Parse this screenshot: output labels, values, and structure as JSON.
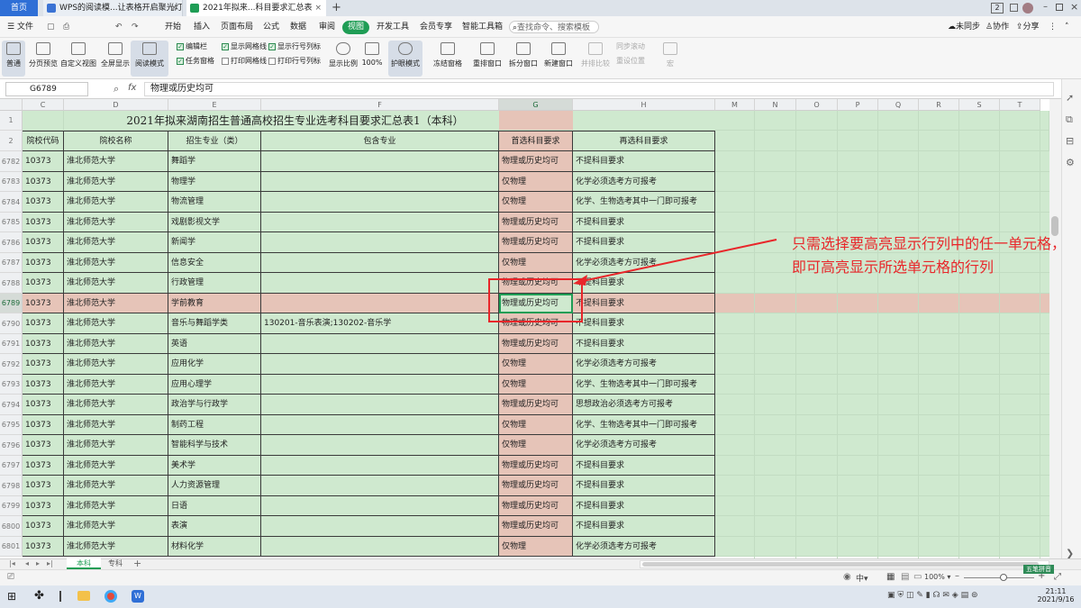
{
  "tabs": [
    {
      "label": "首页",
      "active": false,
      "icon": "home-tab"
    },
    {
      "label": "WPS的阅读模...让表格开启聚光灯",
      "active": false,
      "icon": "wps-doc-icon"
    },
    {
      "label": "2021年拟来...科目要求汇总表",
      "active": true,
      "icon": "sheet-icon"
    }
  ],
  "window_badge": "2",
  "menu": {
    "file": "文件",
    "items": [
      "开始",
      "插入",
      "页面布局",
      "公式",
      "数据",
      "审阅",
      "视图",
      "开发工具",
      "会员专享",
      "智能工具箱"
    ],
    "active_item": "视图",
    "search": "查找命令、搜索模板",
    "unsynced": "未同步",
    "collab": "协作",
    "share": "分享"
  },
  "ribbon": {
    "buttons1": [
      "普通",
      "分页预览",
      "自定义视图",
      "全屏显示",
      "阅读模式"
    ],
    "checks": [
      {
        "label": "编辑栏",
        "checked": true
      },
      {
        "label": "任务窗格",
        "checked": true
      },
      {
        "label": "显示网格线",
        "checked": true
      },
      {
        "label": "打印网格线",
        "checked": false
      },
      {
        "label": "显示行号列标",
        "checked": true
      },
      {
        "label": "打印行号列标",
        "checked": false
      }
    ],
    "zoom_buttons": [
      "显示比例",
      "100%",
      "护眼模式"
    ],
    "window_buttons": [
      "冻结窗格",
      "重排窗口",
      "拆分窗口",
      "新建窗口"
    ],
    "disabled_buttons": [
      "并排比较",
      "同步滚动",
      "重设位置",
      "宏"
    ]
  },
  "formula": {
    "namebox": "G6789",
    "fx": "fx",
    "content": "物理或历史均可"
  },
  "columns": [
    "C",
    "D",
    "E",
    "F",
    "G",
    "H",
    "M",
    "N",
    "O",
    "P",
    "Q",
    "R",
    "S",
    "T"
  ],
  "selected_column": "G",
  "title_row": {
    "row": "1",
    "text": "2021年拟来湖南招生普通高校招生专业选考科目要求汇总表1（本科）"
  },
  "header_row": {
    "row": "2",
    "cells": [
      "院校代码",
      "院校名称",
      "招生专业（类）",
      "包含专业",
      "首选科目要求",
      "再选科目要求"
    ]
  },
  "rows": [
    {
      "row": "6782",
      "code": "10373",
      "school": "淮北师范大学",
      "major": "舞蹈学",
      "incl": "",
      "first": "物理或历史均可",
      "second": "不提科目要求"
    },
    {
      "row": "6783",
      "code": "10373",
      "school": "淮北师范大学",
      "major": "物理学",
      "incl": "",
      "first": "仅物理",
      "second": "化学必须选考方可报考"
    },
    {
      "row": "6784",
      "code": "10373",
      "school": "淮北师范大学",
      "major": "物流管理",
      "incl": "",
      "first": "仅物理",
      "second": "化学、生物选考其中一门即可报考"
    },
    {
      "row": "6785",
      "code": "10373",
      "school": "淮北师范大学",
      "major": "戏剧影视文学",
      "incl": "",
      "first": "物理或历史均可",
      "second": "不提科目要求"
    },
    {
      "row": "6786",
      "code": "10373",
      "school": "淮北师范大学",
      "major": "新闻学",
      "incl": "",
      "first": "物理或历史均可",
      "second": "不提科目要求"
    },
    {
      "row": "6787",
      "code": "10373",
      "school": "淮北师范大学",
      "major": "信息安全",
      "incl": "",
      "first": "仅物理",
      "second": "化学必须选考方可报考"
    },
    {
      "row": "6788",
      "code": "10373",
      "school": "淮北师范大学",
      "major": "行政管理",
      "incl": "",
      "first": "物理或历史均可",
      "second": "不提科目要求"
    },
    {
      "row": "6789",
      "code": "10373",
      "school": "淮北师范大学",
      "major": "学前教育",
      "incl": "",
      "first": "物理或历史均可",
      "second": "不提科目要求"
    },
    {
      "row": "6790",
      "code": "10373",
      "school": "淮北师范大学",
      "major": "音乐与舞蹈学类",
      "incl": "130201-音乐表演;130202-音乐学",
      "first": "物理或历史均可",
      "second": "不提科目要求"
    },
    {
      "row": "6791",
      "code": "10373",
      "school": "淮北师范大学",
      "major": "英语",
      "incl": "",
      "first": "物理或历史均可",
      "second": "不提科目要求"
    },
    {
      "row": "6792",
      "code": "10373",
      "school": "淮北师范大学",
      "major": "应用化学",
      "incl": "",
      "first": "仅物理",
      "second": "化学必须选考方可报考"
    },
    {
      "row": "6793",
      "code": "10373",
      "school": "淮北师范大学",
      "major": "应用心理学",
      "incl": "",
      "first": "仅物理",
      "second": "化学、生物选考其中一门即可报考"
    },
    {
      "row": "6794",
      "code": "10373",
      "school": "淮北师范大学",
      "major": "政治学与行政学",
      "incl": "",
      "first": "物理或历史均可",
      "second": "思想政治必须选考方可报考"
    },
    {
      "row": "6795",
      "code": "10373",
      "school": "淮北师范大学",
      "major": "制药工程",
      "incl": "",
      "first": "仅物理",
      "second": "化学、生物选考其中一门即可报考"
    },
    {
      "row": "6796",
      "code": "10373",
      "school": "淮北师范大学",
      "major": "智能科学与技术",
      "incl": "",
      "first": "仅物理",
      "second": "化学必须选考方可报考"
    },
    {
      "row": "6797",
      "code": "10373",
      "school": "淮北师范大学",
      "major": "美术学",
      "incl": "",
      "first": "物理或历史均可",
      "second": "不提科目要求"
    },
    {
      "row": "6798",
      "code": "10373",
      "school": "淮北师范大学",
      "major": "人力资源管理",
      "incl": "",
      "first": "物理或历史均可",
      "second": "不提科目要求"
    },
    {
      "row": "6799",
      "code": "10373",
      "school": "淮北师范大学",
      "major": "日语",
      "incl": "",
      "first": "物理或历史均可",
      "second": "不提科目要求"
    },
    {
      "row": "6800",
      "code": "10373",
      "school": "淮北师范大学",
      "major": "表演",
      "incl": "",
      "first": "物理或历史均可",
      "second": "不提科目要求"
    },
    {
      "row": "6801",
      "code": "10373",
      "school": "淮北师范大学",
      "major": "材料化学",
      "incl": "",
      "first": "仅物理",
      "second": "化学必须选考方可报考"
    }
  ],
  "selected_row": "6789",
  "annotation": [
    "只需选择要高亮显示行列中的任一单元格，",
    "即可高亮显示所选单元格的行列"
  ],
  "sheets": [
    {
      "label": "本科",
      "active": true
    },
    {
      "label": "专科",
      "active": false
    }
  ],
  "add_sheet": "+",
  "status": {
    "input_mode": "中",
    "zoom": "100%",
    "ime": "五笔拼音"
  },
  "clock": {
    "time": "21:11",
    "date": "2021/9/16"
  },
  "colors": {
    "green_cell": "#cfe9cf",
    "pink_cell": "#e6c4b8",
    "annotation": "#e8262a",
    "accent": "#1f9d55"
  }
}
